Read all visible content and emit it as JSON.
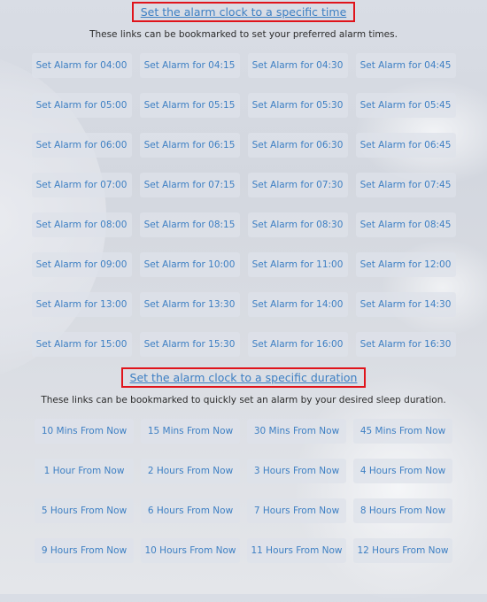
{
  "time_section": {
    "heading": "Set the alarm clock to a specific time",
    "description": "These links can be bookmarked to set your preferred alarm times.",
    "buttons": [
      "Set Alarm for 04:00",
      "Set Alarm for 04:15",
      "Set Alarm for 04:30",
      "Set Alarm for 04:45",
      "Set Alarm for 05:00",
      "Set Alarm for 05:15",
      "Set Alarm for 05:30",
      "Set Alarm for 05:45",
      "Set Alarm for 06:00",
      "Set Alarm for 06:15",
      "Set Alarm for 06:30",
      "Set Alarm for 06:45",
      "Set Alarm for 07:00",
      "Set Alarm for 07:15",
      "Set Alarm for 07:30",
      "Set Alarm for 07:45",
      "Set Alarm for 08:00",
      "Set Alarm for 08:15",
      "Set Alarm for 08:30",
      "Set Alarm for 08:45",
      "Set Alarm for 09:00",
      "Set Alarm for 10:00",
      "Set Alarm for 11:00",
      "Set Alarm for 12:00",
      "Set Alarm for 13:00",
      "Set Alarm for 13:30",
      "Set Alarm for 14:00",
      "Set Alarm for 14:30",
      "Set Alarm for 15:00",
      "Set Alarm for 15:30",
      "Set Alarm for 16:00",
      "Set Alarm for 16:30"
    ]
  },
  "duration_section": {
    "heading": "Set the alarm clock to a specific duration",
    "description": "These links can be bookmarked to quickly set an alarm by your desired sleep duration.",
    "buttons": [
      "10 Mins From Now",
      "15 Mins From Now",
      "30 Mins From Now",
      "45 Mins From Now",
      "1 Hour From Now",
      "2 Hours From Now",
      "3 Hours From Now",
      "4 Hours From Now",
      "5 Hours From Now",
      "6 Hours From Now",
      "7 Hours From Now",
      "8 Hours From Now",
      "9 Hours From Now",
      "10 Hours From Now",
      "11 Hours From Now",
      "12 Hours From Now"
    ]
  },
  "colors": {
    "link": "#3d7fc3",
    "highlight_border": "#e0141b",
    "text": "#2b2b2b"
  }
}
